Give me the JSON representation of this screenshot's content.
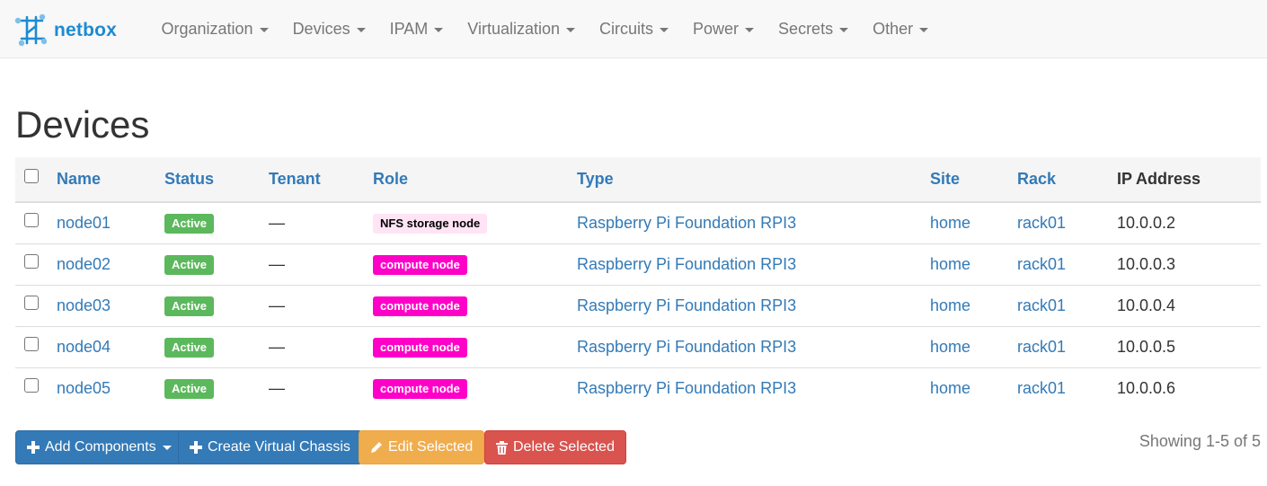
{
  "brand": {
    "name": "netbox"
  },
  "nav": {
    "items": [
      {
        "label": "Organization"
      },
      {
        "label": "Devices"
      },
      {
        "label": "IPAM"
      },
      {
        "label": "Virtualization"
      },
      {
        "label": "Circuits"
      },
      {
        "label": "Power"
      },
      {
        "label": "Secrets"
      },
      {
        "label": "Other"
      }
    ]
  },
  "page": {
    "title": "Devices"
  },
  "table": {
    "columns": {
      "name": "Name",
      "status": "Status",
      "tenant": "Tenant",
      "role": "Role",
      "type": "Type",
      "site": "Site",
      "rack": "Rack",
      "ip": "IP Address"
    },
    "rows": [
      {
        "name": "node01",
        "status": "Active",
        "tenant": "—",
        "role": "NFS storage node",
        "role_bg": "#ffe4f5",
        "role_fg": "#000000",
        "type": "Raspberry Pi Foundation RPI3",
        "site": "home",
        "rack": "rack01",
        "ip": "10.0.0.2"
      },
      {
        "name": "node02",
        "status": "Active",
        "tenant": "—",
        "role": "compute node",
        "role_bg": "#ff00c8",
        "role_fg": "#ffffff",
        "type": "Raspberry Pi Foundation RPI3",
        "site": "home",
        "rack": "rack01",
        "ip": "10.0.0.3"
      },
      {
        "name": "node03",
        "status": "Active",
        "tenant": "—",
        "role": "compute node",
        "role_bg": "#ff00c8",
        "role_fg": "#ffffff",
        "type": "Raspberry Pi Foundation RPI3",
        "site": "home",
        "rack": "rack01",
        "ip": "10.0.0.4"
      },
      {
        "name": "node04",
        "status": "Active",
        "tenant": "—",
        "role": "compute node",
        "role_bg": "#ff00c8",
        "role_fg": "#ffffff",
        "type": "Raspberry Pi Foundation RPI3",
        "site": "home",
        "rack": "rack01",
        "ip": "10.0.0.5"
      },
      {
        "name": "node05",
        "status": "Active",
        "tenant": "—",
        "role": "compute node",
        "role_bg": "#ff00c8",
        "role_fg": "#ffffff",
        "type": "Raspberry Pi Foundation RPI3",
        "site": "home",
        "rack": "rack01",
        "ip": "10.0.0.6"
      }
    ]
  },
  "actions": {
    "add_components": "Add Components",
    "create_virtual_chassis": "Create Virtual Chassis",
    "edit_selected": "Edit Selected",
    "delete_selected": "Delete Selected"
  },
  "pagination": {
    "summary": "Showing 1-5 of 5"
  },
  "colors": {
    "link": "#337ab7",
    "active_status": "#5cb85c",
    "primary": "#337ab7",
    "warning": "#f0ad4e",
    "danger": "#d9534f",
    "brand": "#1c8bd4"
  }
}
